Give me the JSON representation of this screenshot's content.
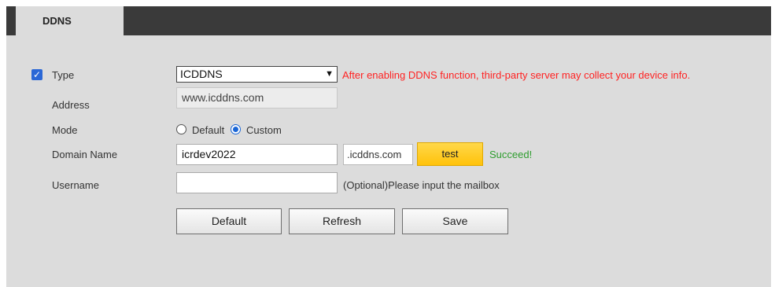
{
  "tab": {
    "label": "DDNS"
  },
  "form": {
    "type": {
      "checked": true,
      "label": "Type",
      "value": "ICDDNS",
      "warning": "After enabling DDNS function, third-party server may collect your device info."
    },
    "address": {
      "label": "Address",
      "value": "www.icddns.com"
    },
    "mode": {
      "label": "Mode",
      "options": [
        "Default",
        "Custom"
      ],
      "selected": "Custom"
    },
    "domain_name": {
      "label": "Domain Name",
      "value": "icrdev2022",
      "suffix": ".icddns.com",
      "test_label": "test",
      "status": "Succeed!"
    },
    "username": {
      "label": "Username",
      "value": "",
      "hint": "(Optional)Please input the mailbox"
    }
  },
  "buttons": {
    "default": "Default",
    "refresh": "Refresh",
    "save": "Save"
  },
  "colors": {
    "warning": "#ff2222",
    "success": "#2e9d2e",
    "test_button": "#ffc20a",
    "tabbar": "#3a3a3a",
    "accent": "#1a66d6"
  }
}
